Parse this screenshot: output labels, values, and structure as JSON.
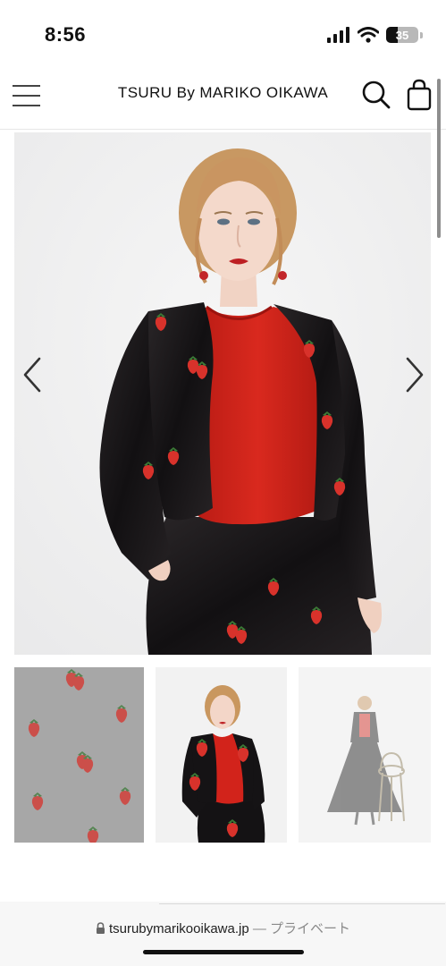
{
  "status_bar": {
    "time": "8:56",
    "battery": "35",
    "battery_level": 0.35
  },
  "header": {
    "brand": "TSURU By MARIKO OIKAWA"
  },
  "gallery": {
    "thumbnails": [
      "thumbnail-fabric-detail",
      "thumbnail-model-upper-body",
      "thumbnail-model-full-body"
    ]
  },
  "url_bar": {
    "domain": "tsurubymarikooikawa.jp",
    "separator": " — ",
    "mode": "プライベート"
  },
  "colors": {
    "velvet_black": "#141214",
    "knit_red": "#d2231b",
    "strawberry": "#d8322b",
    "leaf": "#3c7a36"
  },
  "icons": [
    "menu-icon",
    "search-icon",
    "shopping-bag-icon",
    "chevron-left-icon",
    "chevron-right-icon",
    "lock-icon",
    "signal-icon",
    "wifi-icon",
    "battery-icon"
  ]
}
